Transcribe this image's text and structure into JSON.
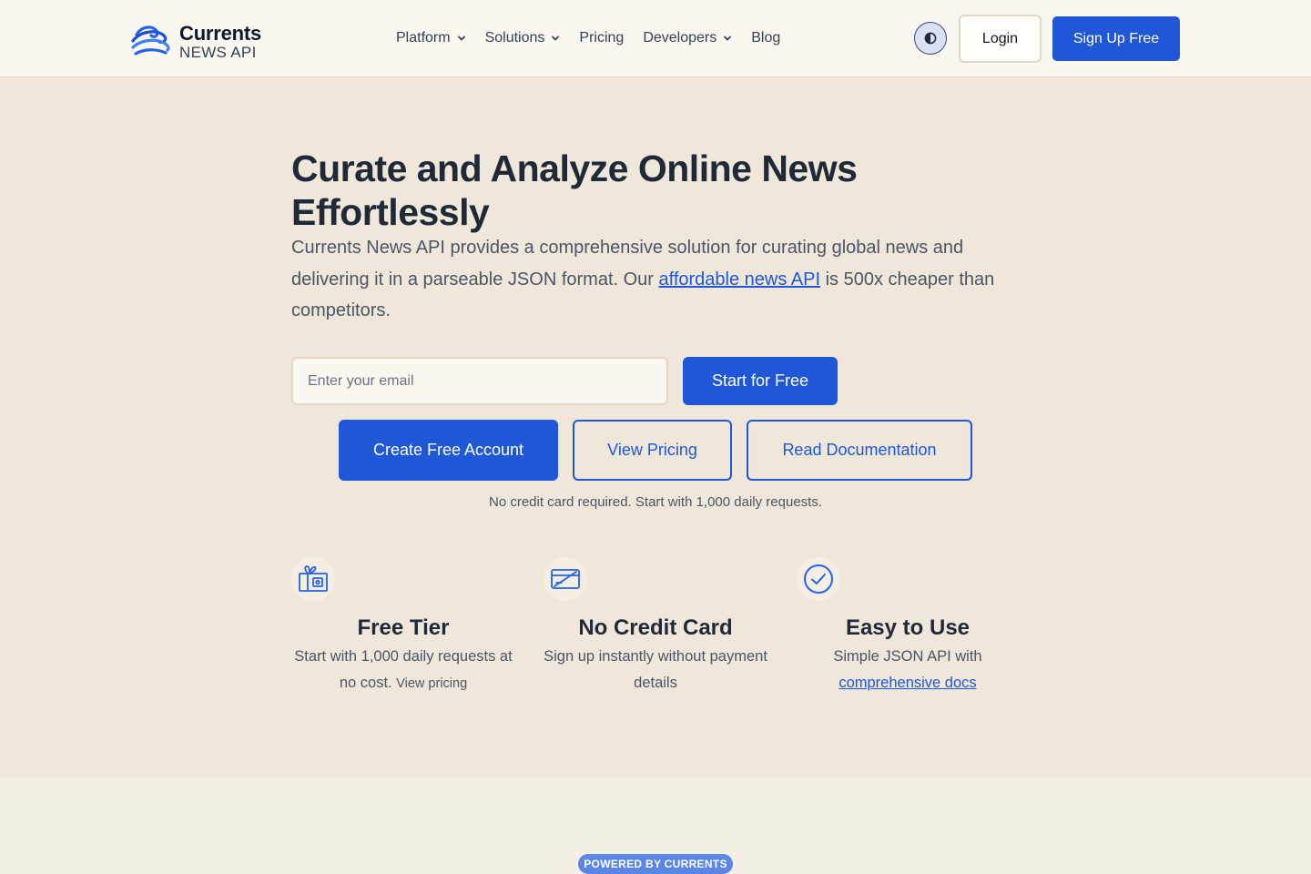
{
  "header": {
    "logo": {
      "name": "Currents",
      "sub": "NEWS API",
      "icon": "wave-logo-icon"
    },
    "nav": [
      {
        "label": "Platform",
        "has_dropdown": true
      },
      {
        "label": "Solutions",
        "has_dropdown": true
      },
      {
        "label": "Pricing",
        "has_dropdown": false
      },
      {
        "label": "Developers",
        "has_dropdown": true
      },
      {
        "label": "Blog",
        "has_dropdown": false
      }
    ],
    "theme_icon": "contrast-icon",
    "login_label": "Login",
    "signup_label": "Sign Up Free"
  },
  "hero": {
    "title": "Curate and Analyze Online News Effortlessly",
    "desc_before": "Currents News API provides a comprehensive solution for curating global news and delivering it in a parseable JSON format. Our ",
    "desc_link": "affordable news API",
    "desc_after": " is 500x cheaper than competitors.",
    "email_placeholder": "Enter your email",
    "start_label": "Start for Free",
    "create_label": "Create Free Account",
    "pricing_label": "View Pricing",
    "docs_label": "Read Documentation",
    "note": "No credit card required. Start with 1,000 daily requests."
  },
  "features": [
    {
      "icon": "gift-icon",
      "title": "Free Tier",
      "text": "Start with 1,000 daily requests at no cost.",
      "link": "View pricing"
    },
    {
      "icon": "credit-card-off-icon",
      "title": "No Credit Card",
      "text": "Sign up instantly without payment details"
    },
    {
      "icon": "check-circle-icon",
      "title": "Easy to Use",
      "text": "Simple JSON API with",
      "link": "comprehensive docs"
    }
  ],
  "badge": "POWERED BY CURRENTS",
  "colors": {
    "accent": "#1f57d6",
    "hero_bg": "#efe7d9",
    "header_bg": "#faf7f1"
  }
}
